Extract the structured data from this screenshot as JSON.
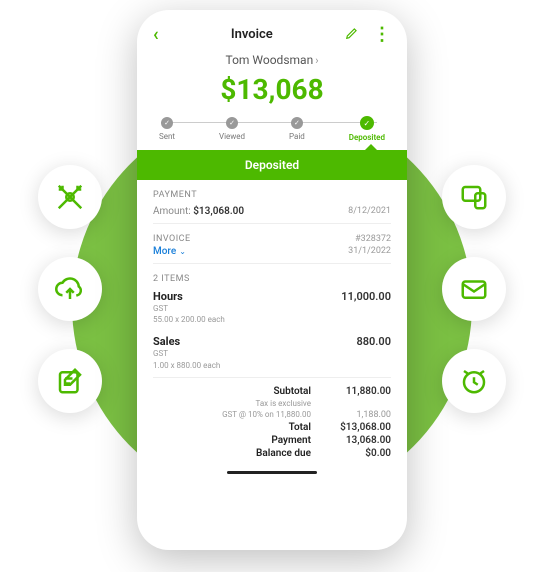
{
  "header": {
    "title": "Invoice",
    "customer": "Tom Woodsman",
    "amount": "$13,068"
  },
  "steps": [
    {
      "label": "Sent",
      "state": "done"
    },
    {
      "label": "Viewed",
      "state": "done"
    },
    {
      "label": "Paid",
      "state": "done"
    },
    {
      "label": "Deposited",
      "state": "current"
    }
  ],
  "ribbon": "Deposited",
  "payment": {
    "title": "PAYMENT",
    "amount_label": "Amount:",
    "amount": "$13,068.00",
    "date": "8/12/2021"
  },
  "invoice": {
    "title": "INVOICE",
    "more": "More",
    "number": "#328372",
    "date": "31/1/2022"
  },
  "items_title": "2 ITEMS",
  "items": [
    {
      "name": "Hours",
      "tax": "GST",
      "each": "55.00 x 200.00 each",
      "price": "11,000.00"
    },
    {
      "name": "Sales",
      "tax": "GST",
      "each": "1.00 x 880.00 each",
      "price": "880.00"
    }
  ],
  "totals": {
    "subtotal_label": "Subtotal",
    "subtotal": "11,880.00",
    "tax_label": "Tax is exclusive",
    "tax_sub": "GST @ 10% on 11,880.00",
    "tax": "1,188.00",
    "total_label": "Total",
    "total": "$13,068.00",
    "payment_label": "Payment",
    "payment": "13,068.00",
    "balance_label": "Balance due",
    "balance": "$0.00"
  }
}
